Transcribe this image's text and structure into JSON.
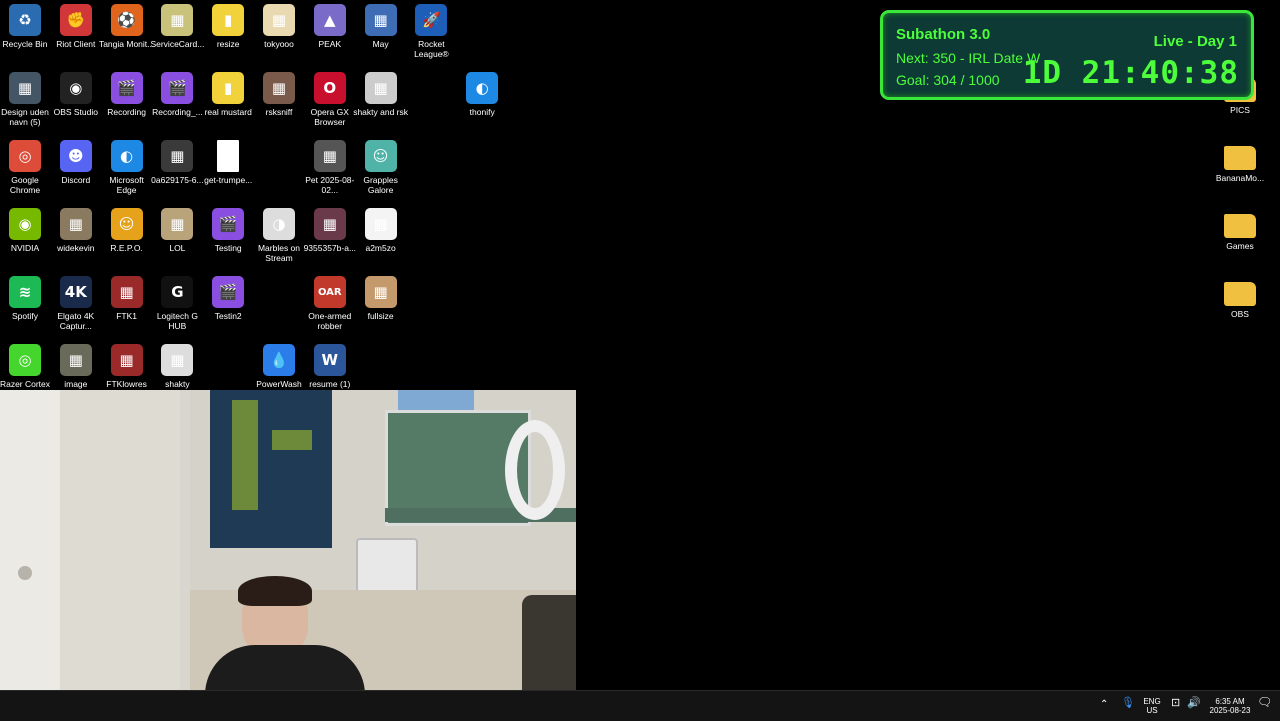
{
  "desktop_icons": [
    {
      "label": "Recycle Bin",
      "icon": "recycle-bin-icon",
      "glyph": "♻",
      "color": "#2b6cb0"
    },
    {
      "label": "Riot Client",
      "icon": "riot-client-icon",
      "glyph": "✊",
      "color": "#d13639"
    },
    {
      "label": "Tangia Monit...",
      "icon": "tangia-icon",
      "glyph": "⚽",
      "color": "#e0641c"
    },
    {
      "label": "ServiceCard...",
      "icon": "image-file-icon",
      "glyph": "▦",
      "color": "#c9c27a"
    },
    {
      "label": "resize",
      "icon": "mustard-image-icon",
      "glyph": "▮",
      "color": "#f2d23a"
    },
    {
      "label": "tokyooo",
      "icon": "image-file-icon",
      "glyph": "▦",
      "color": "#e8d9b0"
    },
    {
      "label": "PEAK",
      "icon": "peak-game-icon",
      "glyph": "▲",
      "color": "#7b6bc9"
    },
    {
      "label": "May",
      "icon": "may-image-icon",
      "glyph": "▦",
      "color": "#3e6db5"
    },
    {
      "label": "Rocket League®",
      "icon": "rocket-league-icon",
      "glyph": "🚀",
      "color": "#1d5fb8"
    },
    {
      "label": "Design uden navn (5)",
      "icon": "image-file-icon",
      "glyph": "▦",
      "color": "#445566"
    },
    {
      "label": "OBS Studio",
      "icon": "obs-studio-icon",
      "glyph": "◉",
      "color": "#222222"
    },
    {
      "label": "Recording",
      "icon": "clapper-icon",
      "glyph": "🎬",
      "color": "#8a4fe0"
    },
    {
      "label": "Recording_...",
      "icon": "clapper-icon",
      "glyph": "🎬",
      "color": "#8a4fe0"
    },
    {
      "label": "real mustard",
      "icon": "mustard-image-icon",
      "glyph": "▮",
      "color": "#f2d23a"
    },
    {
      "label": "rsksniff",
      "icon": "image-file-icon",
      "glyph": "▦",
      "color": "#7a5a4a"
    },
    {
      "label": "Opera GX Browser",
      "icon": "opera-gx-icon",
      "glyph": "O",
      "color": "#c8102e"
    },
    {
      "label": "shakty and rsk",
      "icon": "image-file-icon",
      "glyph": "▦",
      "color": "#cccccc"
    },
    {
      "label": "thonify",
      "icon": "edge-icon",
      "glyph": "◐",
      "color": "#1e88e5"
    },
    {
      "label": "Google Chrome",
      "icon": "chrome-icon",
      "glyph": "◎",
      "color": "#dd4b39"
    },
    {
      "label": "Discord",
      "icon": "discord-icon",
      "glyph": "☻",
      "color": "#5865f2"
    },
    {
      "label": "Microsoft Edge",
      "icon": "edge-icon",
      "glyph": "◐",
      "color": "#1e88e5"
    },
    {
      "label": "0a629175-6...",
      "icon": "image-file-icon",
      "glyph": "▦",
      "color": "#3a3a3a"
    },
    {
      "label": "get-trumpe...",
      "icon": "blank-file-icon",
      "glyph": "",
      "color": "#ffffff"
    },
    {
      "label": "Pet 2025-08-02...",
      "icon": "image-file-icon",
      "glyph": "▦",
      "color": "#555555"
    },
    {
      "label": "Grapples Galore",
      "icon": "grapples-game-icon",
      "glyph": "☺",
      "color": "#4fb3a7"
    },
    {
      "label": "NVIDIA",
      "icon": "nvidia-icon",
      "glyph": "◉",
      "color": "#76b900"
    },
    {
      "label": "widekevin",
      "icon": "image-file-icon",
      "glyph": "▦",
      "color": "#8a7a60"
    },
    {
      "label": "R.E.P.O.",
      "icon": "repo-game-icon",
      "glyph": "☺",
      "color": "#e5a21a"
    },
    {
      "label": "LOL",
      "icon": "image-file-icon",
      "glyph": "▦",
      "color": "#b9a37a"
    },
    {
      "label": "Testing",
      "icon": "clapper-icon",
      "glyph": "🎬",
      "color": "#8a4fe0"
    },
    {
      "label": "Marbles on Stream",
      "icon": "marbles-icon",
      "glyph": "◑",
      "color": "#dddddd"
    },
    {
      "label": "9355357b-a...",
      "icon": "image-file-icon",
      "glyph": "▦",
      "color": "#6a3a4a"
    },
    {
      "label": "a2m5zo",
      "icon": "image-file-icon",
      "glyph": "▦",
      "color": "#f4f4f4"
    },
    {
      "label": "Spotify",
      "icon": "spotify-icon",
      "glyph": "≋",
      "color": "#1db954"
    },
    {
      "label": "Elgato 4K Captur...",
      "icon": "elgato-4k-icon",
      "glyph": "4K",
      "color": "#1a2a4a"
    },
    {
      "label": "FTK1",
      "icon": "image-file-icon",
      "glyph": "▦",
      "color": "#9a2a2a"
    },
    {
      "label": "Logitech G HUB",
      "icon": "logitech-g-icon",
      "glyph": "G",
      "color": "#111111"
    },
    {
      "label": "Testin2",
      "icon": "clapper-icon",
      "glyph": "🎬",
      "color": "#8a4fe0"
    },
    {
      "label": "One-armed robber",
      "icon": "one-armed-robber-icon",
      "glyph": "OAR",
      "color": "#c0392b"
    },
    {
      "label": "fullsize",
      "icon": "cat-image-icon",
      "glyph": "▦",
      "color": "#c49a6c"
    },
    {
      "label": "Razer Cortex",
      "icon": "razer-cortex-icon",
      "glyph": "◎",
      "color": "#44d62c"
    },
    {
      "label": "image",
      "icon": "image-file-icon",
      "glyph": "▦",
      "color": "#6a6a5a"
    },
    {
      "label": "FTKlowres",
      "icon": "image-file-icon",
      "glyph": "▦",
      "color": "#9a2a2a"
    },
    {
      "label": "shakty",
      "icon": "image-file-icon",
      "glyph": "▦",
      "color": "#dddddd"
    },
    {
      "label": "PowerWash",
      "icon": "powerwash-icon",
      "glyph": "💧",
      "color": "#2b7de9"
    },
    {
      "label": "resume (1)",
      "icon": "word-document-icon",
      "glyph": "W",
      "color": "#2b579a"
    },
    {
      "label": "PICS",
      "icon": "folder-icon",
      "glyph": "",
      "color": "#f0c040"
    },
    {
      "label": "BananaMo...",
      "icon": "folder-icon",
      "glyph": "",
      "color": "#f0c040"
    },
    {
      "label": "Games",
      "icon": "folder-games-icon",
      "glyph": "",
      "color": "#f0c040"
    },
    {
      "label": "OBS",
      "icon": "folder-icon",
      "glyph": "",
      "color": "#f0c040"
    }
  ],
  "overlay": {
    "title": "Subathon 3.0",
    "next": "Next: 350 - IRL Date Wit",
    "goal": "Goal: 304 / 1000",
    "live": "Live - Day 1",
    "timer": "1D 21:40:38",
    "accent": "#4cff3a"
  },
  "taskbar": {
    "lang_top": "ENG",
    "lang_bottom": "US",
    "time": "6:35 AM",
    "date": "2025-08-23"
  }
}
